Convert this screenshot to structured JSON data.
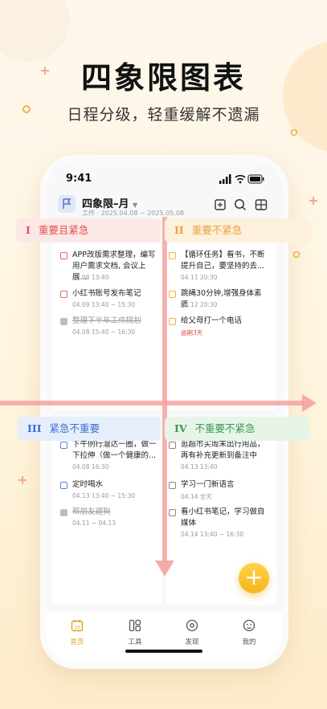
{
  "hero": {
    "title": "四象限图表",
    "subtitle": "日程分级，轻重缓解不遗漏"
  },
  "status": {
    "time": "9:41"
  },
  "header": {
    "title": "四象限–月",
    "meta": "工作 · 2025.04.08 ~ 2025.05.08"
  },
  "quadrants": [
    {
      "numeral": "I",
      "label": "重要且紧急",
      "color": "#e05252",
      "bg": "#fce8e6",
      "items": [
        {
          "text": "APP改版需求整理，编写用户需求文档, 会议上展...",
          "date": "04.08 13:40",
          "done": false
        },
        {
          "text": "小红书账号发布笔记",
          "date": "04.09 13:40 ~ 15:30",
          "done": false
        },
        {
          "text": "整理下半年工作规划",
          "date": "04.08 15:40 ~ 16:30",
          "done": true
        }
      ]
    },
    {
      "numeral": "II",
      "label": "重要不紧急",
      "color": "#e8a23a",
      "bg": "#fdf0dc",
      "items": [
        {
          "text": "【循环任务】看书，不断提升自己，要坚持的去...",
          "date": "04.11 20:30",
          "done": false
        },
        {
          "text": "跳绳30分钟,增强身体素质",
          "date": "04.12 20:30",
          "done": false
        },
        {
          "text": "给父母打一个电话",
          "date": "逾期3天",
          "done": false,
          "overdue": true
        }
      ]
    },
    {
      "numeral": "III",
      "label": "紧急不重要",
      "color": "#3d6fd1",
      "bg": "#e6eefb",
      "items": [
        {
          "text": "下午例行溜达一圈，做一下拉伸（做一个健康的...",
          "date": "04.08 16:30",
          "done": false
        },
        {
          "text": "定时喝水",
          "date": "04.13 13:40 ~ 15:30",
          "done": false
        },
        {
          "text": "帮朋友遛狗",
          "date": "04.11 ~ 04.13",
          "done": true
        }
      ]
    },
    {
      "numeral": "IV",
      "label": "不重要不紧急",
      "color": "#3a9a55",
      "bg": "#e7f4e8",
      "items": [
        {
          "text": "逛超市买周末出行用品，再有补充更新到备注中",
          "date": "04.13 13:40",
          "done": false
        },
        {
          "text": "学习一门新语言",
          "date": "04.14 全天",
          "done": false
        },
        {
          "text": "看小红书笔记，学习做自媒体",
          "date": "04.14 13:40 ~ 16:30",
          "done": false
        }
      ]
    }
  ],
  "tabs": [
    {
      "label": "首页",
      "icon": "calendar-icon",
      "active": true
    },
    {
      "label": "工具",
      "icon": "tools-icon",
      "active": false
    },
    {
      "label": "发现",
      "icon": "discover-icon",
      "active": false
    },
    {
      "label": "我的",
      "icon": "profile-icon",
      "active": false
    }
  ],
  "fab": {
    "label": "+"
  }
}
